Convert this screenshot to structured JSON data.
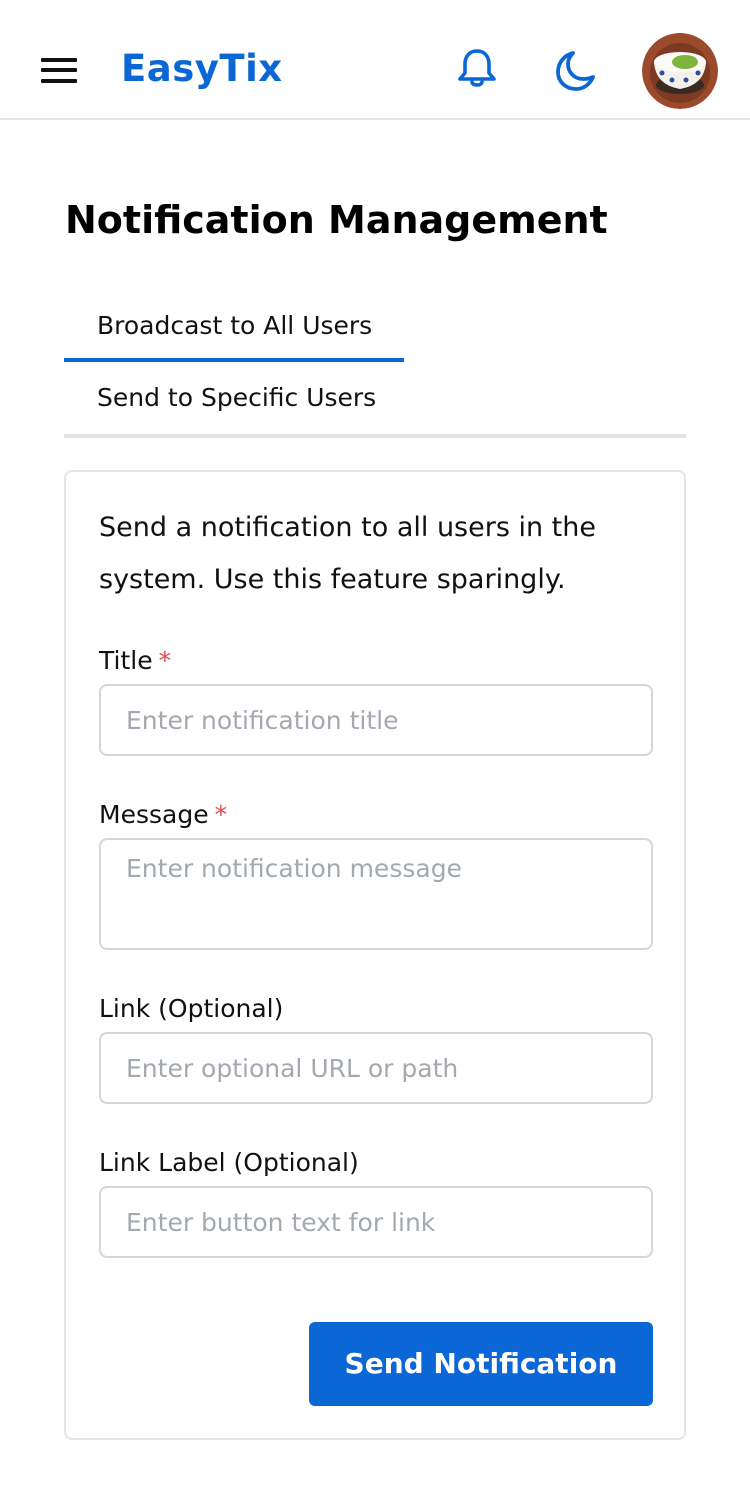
{
  "header": {
    "brand": "EasyTix",
    "icons": {
      "menu": "hamburger-menu-icon",
      "notifications": "bell-icon",
      "theme": "moon-icon",
      "avatar": "user-avatar"
    },
    "accent_color": "#0b67d6"
  },
  "page": {
    "title": "Notification Management"
  },
  "tabs": [
    {
      "label": "Broadcast to All Users",
      "active": true
    },
    {
      "label": "Send to Specific Users",
      "active": false
    }
  ],
  "form": {
    "description": "Send a notification to all users in the system. Use this feature sparingly.",
    "title_field": {
      "label": "Title",
      "required_mark": "*",
      "placeholder": "Enter notification title",
      "value": ""
    },
    "message_field": {
      "label": "Message",
      "required_mark": "*",
      "placeholder": "Enter notification message",
      "value": ""
    },
    "link_field": {
      "label": "Link (Optional)",
      "placeholder": "Enter optional URL or path",
      "value": ""
    },
    "link_label_field": {
      "label": "Link Label (Optional)",
      "placeholder": "Enter button text for link",
      "value": ""
    },
    "submit_label": "Send Notification"
  },
  "colors": {
    "accent": "#0b67d6",
    "required": "#e5484d",
    "border": "#d3d6da"
  }
}
